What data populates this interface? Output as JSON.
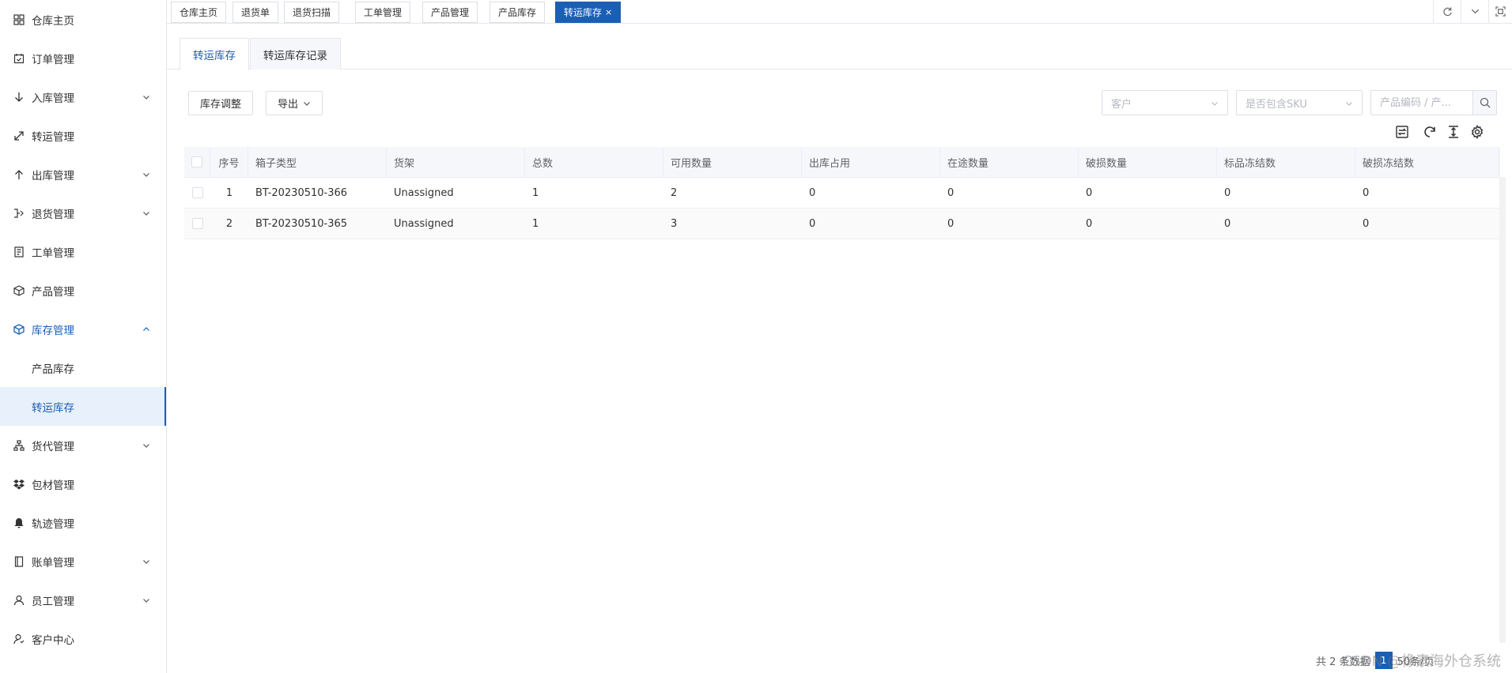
{
  "sidebar": {
    "items": [
      {
        "label": "仓库主页",
        "icon": "grid-icon",
        "has_children": false
      },
      {
        "label": "订单管理",
        "icon": "calendar-check-icon",
        "has_children": false
      },
      {
        "label": "入库管理",
        "icon": "arrow-down-icon",
        "has_children": true
      },
      {
        "label": "转运管理",
        "icon": "diagonal-arrow-icon",
        "has_children": false
      },
      {
        "label": "出库管理",
        "icon": "arrow-up-icon",
        "has_children": true
      },
      {
        "label": "退货管理",
        "icon": "return-icon",
        "has_children": true
      },
      {
        "label": "工单管理",
        "icon": "document-icon",
        "has_children": false
      },
      {
        "label": "产品管理",
        "icon": "box-icon",
        "has_children": false
      },
      {
        "label": "库存管理",
        "icon": "cube-icon",
        "has_children": true,
        "expanded": true
      },
      {
        "label": "货代管理",
        "icon": "hierarchy-icon",
        "has_children": true
      },
      {
        "label": "包材管理",
        "icon": "package-icon",
        "has_children": false
      },
      {
        "label": "轨迹管理",
        "icon": "bell-icon",
        "has_children": false
      },
      {
        "label": "账单管理",
        "icon": "book-icon",
        "has_children": true
      },
      {
        "label": "员工管理",
        "icon": "user-icon",
        "has_children": true
      },
      {
        "label": "客户中心",
        "icon": "customer-icon",
        "has_children": false
      }
    ],
    "inventory_sub": [
      "产品库存",
      "转运库存"
    ]
  },
  "top_tabs": [
    "仓库主页",
    "退货单",
    "退货扫描",
    "工单管理",
    "产品管理",
    "产品库存",
    "转运库存"
  ],
  "active_top_tab_close": "×",
  "content_tabs": [
    "转运库存",
    "转运库存记录"
  ],
  "toolbar": {
    "adjust_label": "库存调整",
    "export_label": "导出",
    "customer_placeholder": "客户",
    "sku_placeholder": "是否包含SKU",
    "search_placeholder": "产品编码 / 产..."
  },
  "table": {
    "headers": [
      "序号",
      "箱子类型",
      "货架",
      "总数",
      "可用数量",
      "出库占用",
      "在途数量",
      "破损数量",
      "标品冻结数",
      "破损冻结数"
    ],
    "rows": [
      [
        "1",
        "BT-20230510-366",
        "Unassigned",
        "1",
        "2",
        "0",
        "0",
        "0",
        "0",
        "0"
      ],
      [
        "2",
        "BT-20230510-365",
        "Unassigned",
        "1",
        "3",
        "0",
        "0",
        "0",
        "0",
        "0"
      ]
    ]
  },
  "footer": {
    "total_text": "共 2 条数据",
    "page": "1",
    "page_size": "50条/页"
  },
  "watermark": "CSDN @橡素海外仓系统",
  "colors": {
    "accent": "#1b5fb4",
    "border": "#dcdfe6",
    "header_bg": "#f5f7fa"
  }
}
